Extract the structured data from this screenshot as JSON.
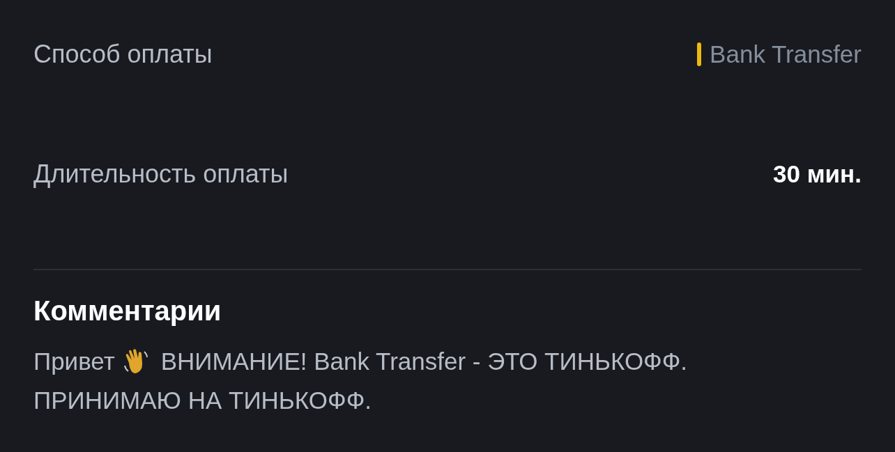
{
  "details": [
    {
      "label": "Способ оплаты",
      "kind": "payment",
      "value": "Bank Transfer",
      "color": "#f0b90b"
    },
    {
      "label": "Длительность оплаты",
      "kind": "plain",
      "value": "30 мин."
    }
  ],
  "comments": {
    "title": "Комментарии",
    "greeting": "Привет",
    "message_lines": [
      "ВНИМАНИЕ! Bank Transfer - ЭТО ТИНЬКОФФ.",
      "ПРИНИМАЮ НА ТИНЬКОФФ."
    ]
  }
}
